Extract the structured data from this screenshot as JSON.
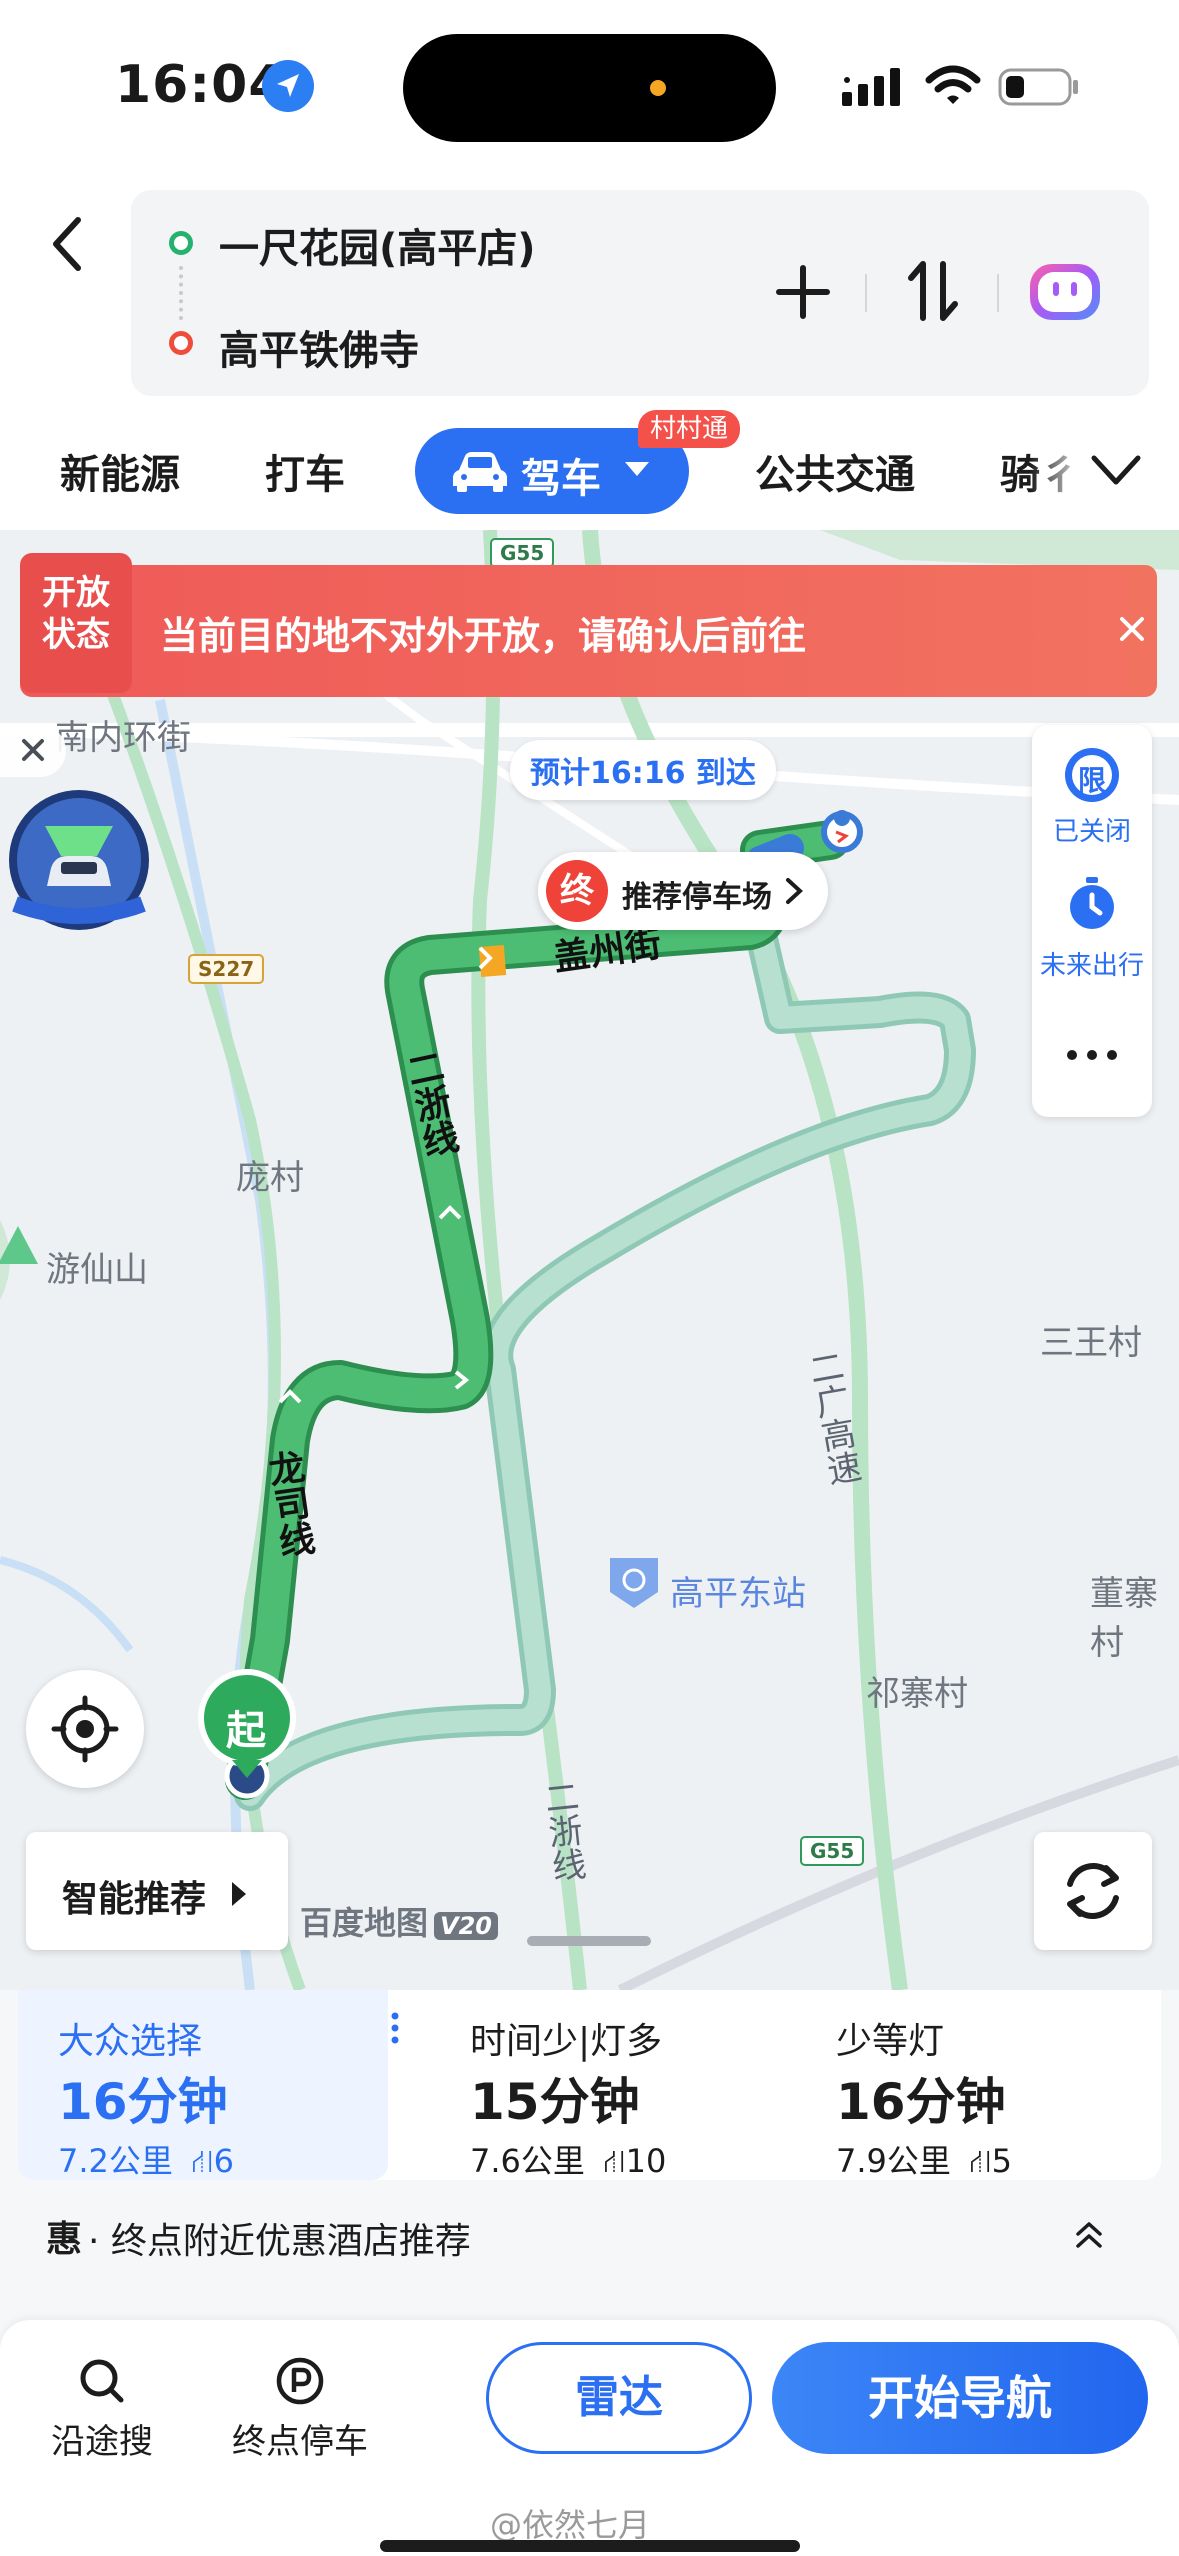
{
  "status_bar": {
    "time": "16:04"
  },
  "route": {
    "origin": "一尺花园(高平店)",
    "destination": "高平铁佛寺"
  },
  "tabs": {
    "items": [
      "新能源",
      "打车",
      "驾车",
      "公共交通",
      "骑行"
    ],
    "active_label": "驾车",
    "active_badge": "村村通",
    "more_label": "骑彳"
  },
  "alert": {
    "tag_line1": "开放",
    "tag_line2": "状态",
    "message": "当前目的地不对外开放，请确认后前往"
  },
  "map": {
    "eta": "预计16:16 到达",
    "end_marker": "终",
    "parking_label": "推荐停车场",
    "start_marker": "起",
    "places": [
      "南内环街",
      "庞村",
      "游仙山",
      "三王村",
      "高平东站",
      "董寨村",
      "祁寨村"
    ],
    "roads": {
      "gaizhou": "盖州街",
      "erzhe": "二浙线",
      "longsi": "龙司线",
      "erguang": "二广高速",
      "erzhe2": "二浙线"
    },
    "shields": [
      "G55",
      "S227",
      "G55"
    ],
    "logo": "百度地图",
    "logo_version": "V20"
  },
  "side_panel": {
    "limit_label": "已关闭",
    "limit_icon_text": "限",
    "future_label": "未来出行"
  },
  "controls": {
    "smart_label": "智能推荐"
  },
  "route_options": [
    {
      "label": "大众选择",
      "time": "16分钟",
      "distance": "7.2公里",
      "lights": "6",
      "selected": true
    },
    {
      "label": "时间少|灯多",
      "time": "15分钟",
      "distance": "7.6公里",
      "lights": "10",
      "selected": false
    },
    {
      "label": "少等灯",
      "time": "16分钟",
      "distance": "7.9公里",
      "lights": "5",
      "selected": false
    }
  ],
  "hotel": {
    "icon": "惠",
    "text": "· 终点附近优惠酒店推荐"
  },
  "actions": {
    "search_along": "沿途搜",
    "end_parking": "终点停车",
    "radar": "雷达",
    "start_nav": "开始导航"
  },
  "watermark": "@依然七月",
  "colors": {
    "accent": "#2b6ff2",
    "route_green": "#3fb26a",
    "alert_red": "#ef5a58"
  }
}
